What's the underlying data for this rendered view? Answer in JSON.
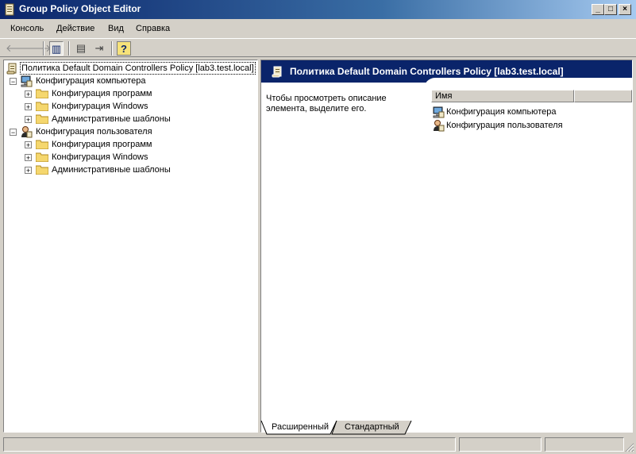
{
  "window": {
    "title": "Group Policy Object Editor",
    "controls": {
      "minimize": "_",
      "maximize": "□",
      "close": "×"
    }
  },
  "menu": {
    "items": [
      {
        "label": "Консоль"
      },
      {
        "label": "Действие"
      },
      {
        "label": "Вид"
      },
      {
        "label": "Справка"
      }
    ]
  },
  "toolbar": {
    "buttons": [
      {
        "icon": "back-arrow-icon",
        "glyph": "🡐"
      },
      {
        "icon": "forward-arrow-icon",
        "glyph": "🡒"
      },
      {
        "icon": "show-hide-tree-icon",
        "glyph": "▥"
      },
      {
        "icon": "properties-icon",
        "glyph": "▤"
      },
      {
        "icon": "export-list-icon",
        "glyph": "⇥"
      },
      {
        "icon": "help-icon",
        "glyph": "?"
      }
    ]
  },
  "tree": {
    "root": "Политика Default Domain Controllers Policy [lab3.test.local]",
    "computer": {
      "label": "Конфигурация компьютера",
      "children": [
        "Конфигурация программ",
        "Конфигурация Windows",
        "Административные шаблоны"
      ]
    },
    "user": {
      "label": "Конфигурация пользователя",
      "children": [
        "Конфигурация программ",
        "Конфигурация Windows",
        "Административные шаблоны"
      ]
    }
  },
  "details": {
    "header": "Политика Default Domain Controllers Policy [lab3.test.local]",
    "description": "Чтобы просмотреть описание элемента, выделите его.",
    "column_name": "Имя",
    "items": [
      "Конфигурация компьютера",
      "Конфигурация пользователя"
    ]
  },
  "tabs": {
    "extended": "Расширенный",
    "standard": "Стандартный"
  },
  "colors": {
    "titlebar": "#0a246a",
    "face": "#d4d0c8",
    "folder": "#f5d76e"
  }
}
